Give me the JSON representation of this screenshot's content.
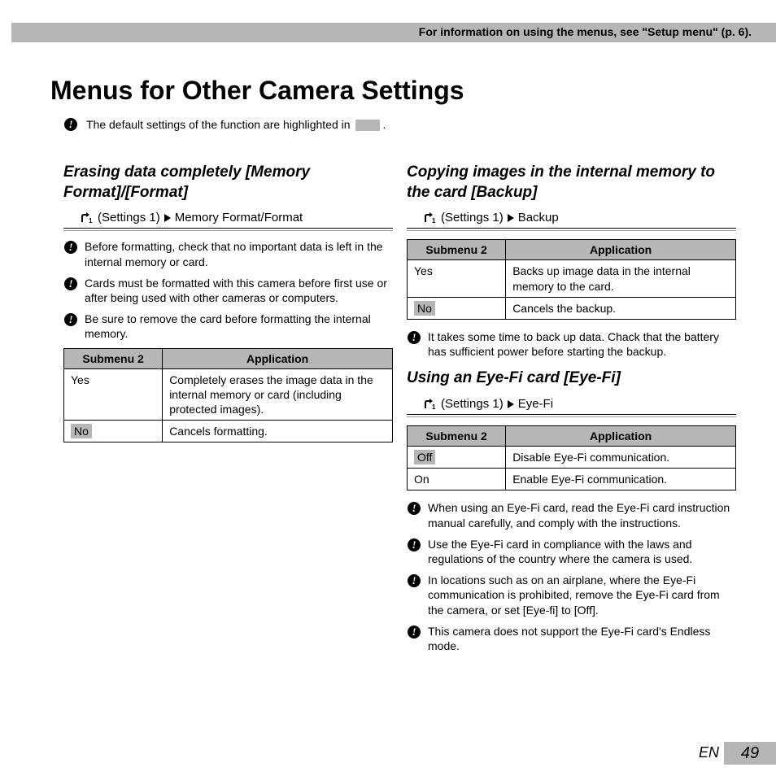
{
  "header_note": "For information on using the menus, see \"Setup menu\" (p. 6).",
  "page_title": "Menus for Other Camera Settings",
  "intro_note_part1": "The default settings of the function are highlighted in",
  "intro_note_part2": ".",
  "settings_label": "(Settings 1)",
  "headers": {
    "submenu": "Submenu 2",
    "application": "Application"
  },
  "sections": {
    "format": {
      "title": "Erasing data completely [Memory Format]/[Format]",
      "path_suffix": "Memory Format/Format",
      "notes": [
        "Before formatting, check that no important data is left in the internal memory or card.",
        "Cards must be formatted with this camera before first use or after being used with other cameras or computers.",
        "Be sure to remove the card before formatting the internal memory."
      ],
      "rows": [
        {
          "k": "Yes",
          "v": "Completely erases the image data in the internal memory or card (including protected images).",
          "hl": false
        },
        {
          "k": "No",
          "v": "Cancels formatting.",
          "hl": true
        }
      ]
    },
    "backup": {
      "title": "Copying images in the internal memory to the card [Backup]",
      "path_suffix": "Backup",
      "rows": [
        {
          "k": "Yes",
          "v": "Backs up image data in the internal memory to the card.",
          "hl": false
        },
        {
          "k": "No",
          "v": "Cancels the backup.",
          "hl": true
        }
      ],
      "notes_after": [
        "It takes some time to back up data. Chack that the battery has sufficient power before starting the backup."
      ]
    },
    "eyefi": {
      "title": "Using an Eye-Fi card [Eye-Fi]",
      "path_suffix": "Eye-Fi",
      "rows": [
        {
          "k": "Off",
          "v": "Disable Eye-Fi communication.",
          "hl": true
        },
        {
          "k": "On",
          "v": "Enable Eye-Fi communication.",
          "hl": false
        }
      ],
      "notes_after": [
        "When using an Eye-Fi card, read the Eye-Fi card instruction manual carefully, and comply with the instructions.",
        "Use the Eye-Fi card in compliance with the laws and regulations of the country where the camera is used.",
        "In locations such as on an airplane, where the Eye-Fi communication is prohibited, remove the Eye-Fi card from the camera, or set [Eye-fi] to [Off].",
        "This camera does not support the Eye-Fi card's Endless mode."
      ]
    }
  },
  "footer": {
    "lang": "EN",
    "page": "49"
  }
}
